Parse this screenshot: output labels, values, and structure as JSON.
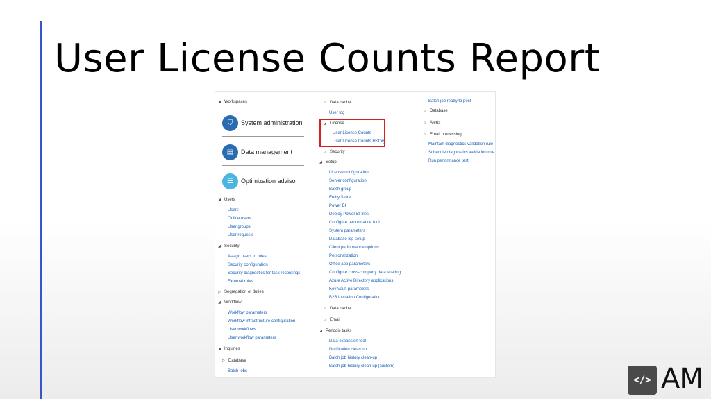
{
  "slide": {
    "title": "User License Counts Report"
  },
  "brand": {
    "icon": "code-brackets-icon",
    "glyph": "</>",
    "letters": "AM",
    "accent": "#3a55c8",
    "highlight": "#d32020"
  },
  "col1": {
    "workspaces_label": "Workspaces",
    "tiles": [
      {
        "label": "System administration",
        "icon": "shield-icon"
      },
      {
        "label": "Data management",
        "icon": "database-icon"
      },
      {
        "label": "Optimization advisor",
        "icon": "list-icon"
      }
    ],
    "users_label": "Users",
    "users_items": [
      "Users",
      "Online users",
      "User groups",
      "User requests"
    ],
    "security_label": "Security",
    "security_items": [
      "Assign users to roles",
      "Security configuration",
      "Security diagnostics for task recordings",
      "External roles"
    ],
    "segregation_label": "Segregation of duties",
    "workflow_label": "Workflow",
    "workflow_items": [
      "Workflow parameters",
      "Workflow infrastructure configuration",
      "User workflows",
      "User workflow parameters"
    ],
    "inquiries_label": "Inquiries",
    "database_label": "Database",
    "batch_jobs": "Batch jobs"
  },
  "col2": {
    "data_cache_top": "Data cache",
    "user_log": "User log",
    "license_label": "License",
    "license_items": [
      "User License Counts",
      "User License Counts History"
    ],
    "security_label": "Security",
    "setup_label": "Setup",
    "setup_items": [
      "License configuration",
      "Server configuration",
      "Batch group",
      "Entity Store",
      "Power BI",
      "Deploy Power BI files",
      "Configure performance tool",
      "System parameters",
      "Database log setup",
      "Client performance options",
      "Personalization",
      "Office app parameters",
      "Configure cross-company data sharing",
      "Azure Active Directory applications",
      "Key Vault parameters",
      "B2B Invitation Configuration"
    ],
    "data_cache_label": "Data cache",
    "email_label": "Email",
    "periodic_label": "Periodic tasks",
    "periodic_items": [
      "Data expansion tool",
      "Notification clean up",
      "Batch job history clean-up",
      "Batch job history clean-up (custom)"
    ]
  },
  "col3": {
    "batch_ready": "Batch job ready to post",
    "database_label": "Database",
    "alerts_label": "Alerts",
    "email_processing_label": "Email processing",
    "diag_items": [
      "Maintain diagnostics validation rule",
      "Schedule diagnostics validation rule",
      "Run performance test"
    ]
  }
}
